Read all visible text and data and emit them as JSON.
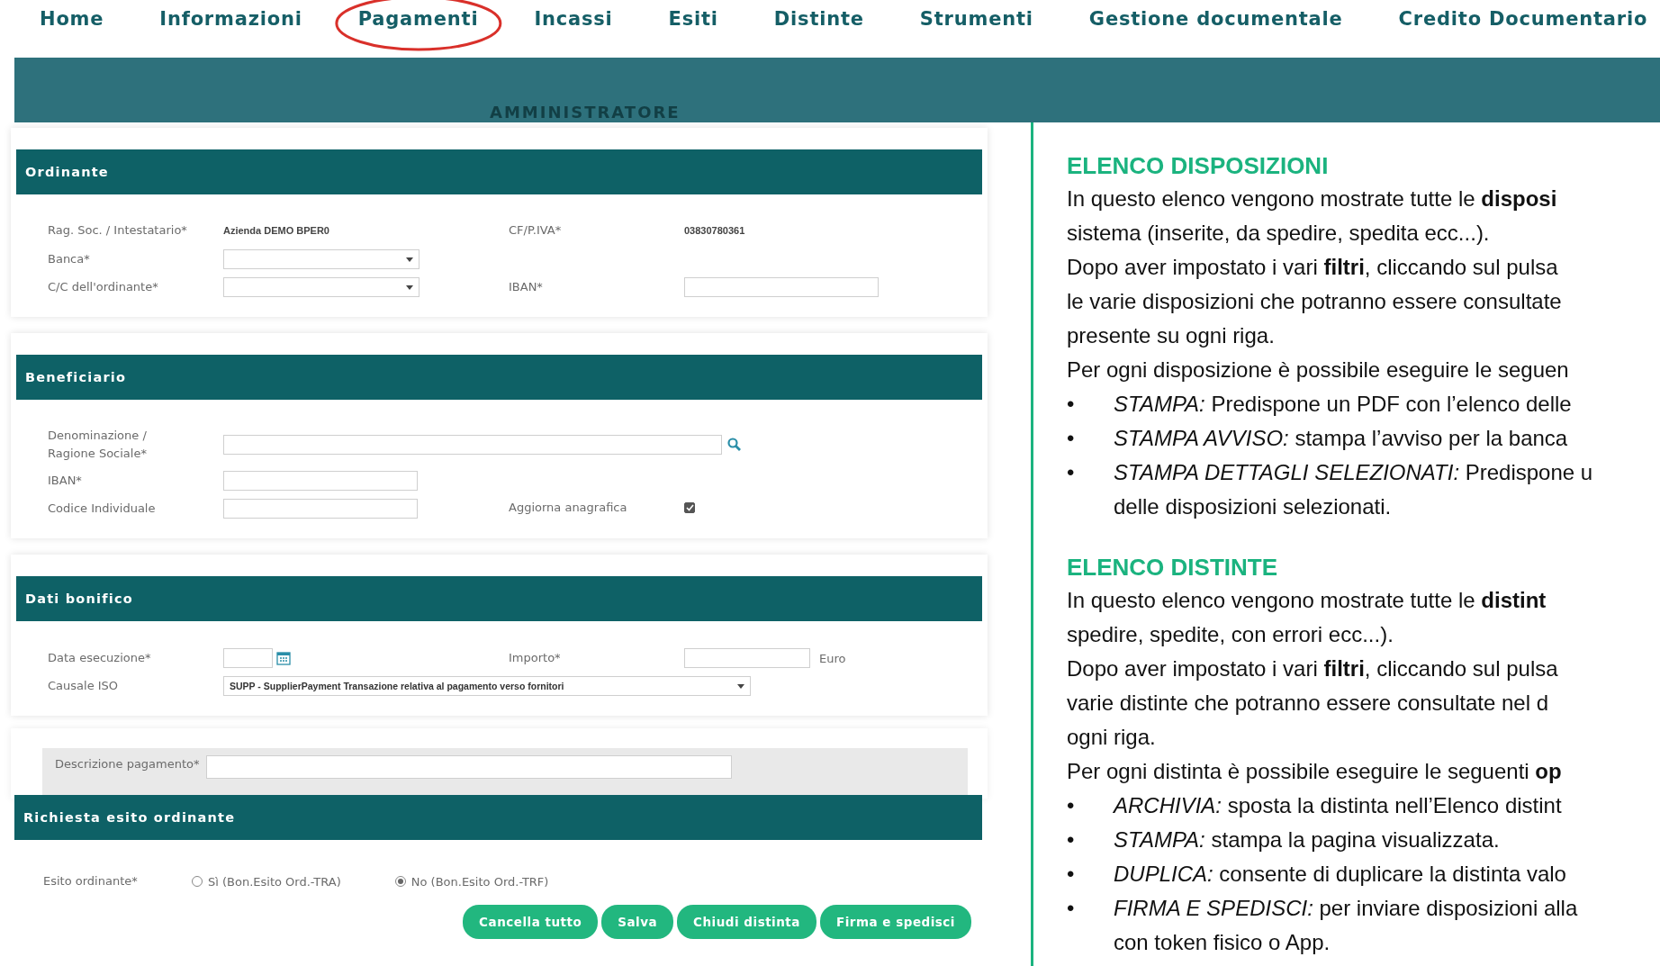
{
  "nav": {
    "items": [
      {
        "label": "Home",
        "circled": false
      },
      {
        "label": "Informazioni",
        "circled": false
      },
      {
        "label": "Pagamenti",
        "circled": true
      },
      {
        "label": "Incassi",
        "circled": false
      },
      {
        "label": "Esiti",
        "circled": false
      },
      {
        "label": "Distinte",
        "circled": false
      },
      {
        "label": "Strumenti",
        "circled": false
      },
      {
        "label": "Gestione documentale",
        "circled": false
      },
      {
        "label": "Credito Documentario",
        "circled": false
      }
    ]
  },
  "banner": {
    "role": "AMMINISTRATORE"
  },
  "cards": [
    {
      "title": "Ordinante",
      "rows": [
        [
          {
            "label": "Rag. Soc. / Intestatario*",
            "kind": "value",
            "value": "Azienda DEMO BPER0"
          },
          {
            "label": "CF/P.IVA*",
            "kind": "value",
            "value": "03830780361"
          }
        ],
        [
          {
            "label": "Banca*",
            "kind": "select"
          }
        ],
        [
          {
            "label": "C/C dell'ordinante*",
            "kind": "select"
          },
          {
            "label": "IBAN*",
            "kind": "input"
          }
        ]
      ]
    },
    {
      "title": "Beneficiario",
      "rows": [
        [
          {
            "label": "Denominazione / Ragione Sociale*",
            "kind": "search"
          }
        ],
        [
          {
            "label": "IBAN*",
            "kind": "input"
          }
        ],
        [
          {
            "label": "Codice Individuale",
            "kind": "input"
          },
          {
            "label": "Aggiorna anagrafica",
            "kind": "checkbox",
            "checked": true
          }
        ]
      ]
    },
    {
      "title": "Dati bonifico",
      "rows": [
        [
          {
            "label": "Data esecuzione*",
            "kind": "date"
          },
          {
            "label": "Importo*",
            "kind": "amount",
            "unit": "Euro"
          }
        ],
        [
          {
            "label": "Causale ISO",
            "kind": "select-wide",
            "value": "SUPP - SupplierPayment Transazione relativa al pagamento verso fornitori"
          }
        ]
      ]
    }
  ],
  "description": {
    "label": "Descrizione pagamento*"
  },
  "esito": {
    "title": "Richiesta esito ordinante",
    "label": "Esito ordinante*",
    "options": [
      {
        "label": "Sì (Bon.Esito Ord.-TRA)",
        "selected": false
      },
      {
        "label": "No (Bon.Esito Ord.-TRF)",
        "selected": true
      }
    ]
  },
  "buttons": [
    "Cancella tutto",
    "Salva",
    "Chiudi distinta",
    "Firma e spedisci"
  ],
  "help": [
    {
      "title": "ELENCO DISPOSIZIONI",
      "lines": [
        "In questo elenco vengono mostrate tutte le **disposi**",
        "sistema (inserite, da spedire, spedita ecc...).",
        "Dopo aver impostato i vari **filtri**, cliccando sul pulsa",
        "le varie disposizioni che potranno essere consultate",
        "presente su ogni riga.",
        "Per ogni disposizione è possibile eseguire le seguen"
      ],
      "bullets": [
        {
          "mark": "•",
          "lines": [
            "*STAMPA:* Predispone un PDF con l’elenco delle"
          ]
        },
        {
          "mark": "•",
          "lines": [
            "*STAMPA AVVISO:* stampa l’avviso per la banca"
          ]
        },
        {
          "mark": "•",
          "lines": [
            "*STAMPA DETTAGLI SELEZIONATI:* Predispone u",
            "delle disposizioni selezionati."
          ]
        }
      ]
    },
    {
      "title": "ELENCO DISTINTE",
      "lines": [
        "In questo elenco vengono mostrate tutte le **distint**",
        "spedire, spedite, con errori ecc...).",
        "Dopo aver impostato i vari **filtri**, cliccando sul pulsa",
        "varie distinte che potranno essere consultate nel d",
        "ogni riga.",
        "Per ogni distinta è possibile eseguire le seguenti **op**"
      ],
      "bullets": [
        {
          "mark": "•",
          "lines": [
            "*ARCHIVIA:* sposta la distinta nell’Elenco distint"
          ]
        },
        {
          "mark": "•",
          "lines": [
            "*STAMPA:* stampa la pagina visualizzata."
          ]
        },
        {
          "mark": "•",
          "lines": [
            "*DUPLICA:* consente di duplicare la distinta valo"
          ]
        },
        {
          "mark": "•",
          "lines": [
            "*FIRMA E SPEDISCI:* per inviare disposizioni alla",
            "con token fisico o App."
          ]
        }
      ]
    }
  ]
}
